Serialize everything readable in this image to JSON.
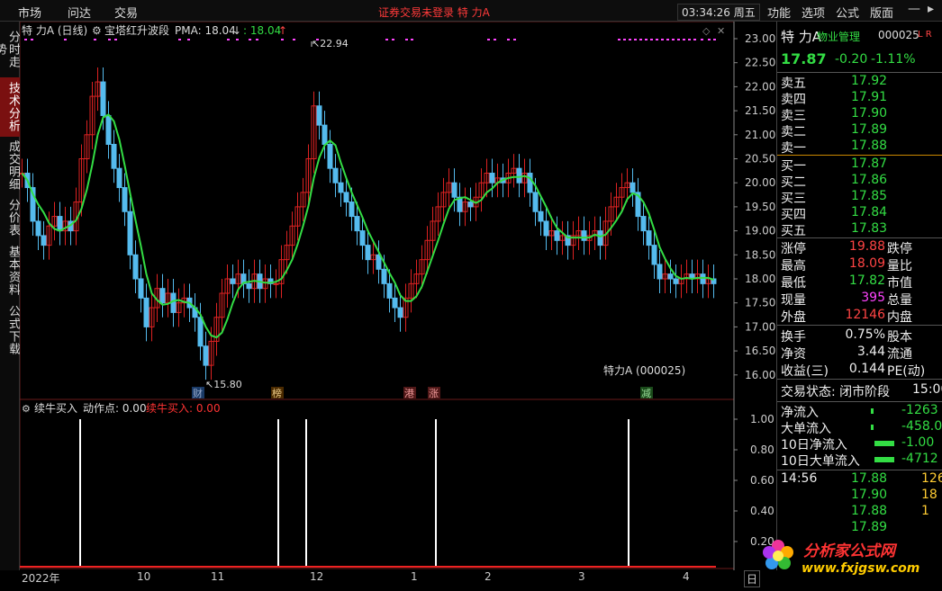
{
  "topbar": {
    "menu_left": [
      "市场",
      "问达",
      "交易"
    ],
    "login_status": "证券交易未登录  特 力A",
    "clock": "03:34:26 周五",
    "menu_right": [
      "功能",
      "选项",
      "公式",
      "版面"
    ]
  },
  "left_tabs": [
    "分时走势",
    "技术分析",
    "成交明细",
    "分价表",
    "基本资料",
    "公式下载"
  ],
  "main_chart": {
    "title": "特 力A (日线)",
    "indicator": "宝塔红升波段",
    "pma_label": "PMA: 18.04",
    "pma2_label": ": 18.04",
    "high_label": "22.94",
    "low_label": "15.80",
    "stock_label": "特力A (000025)",
    "markers": [
      "财",
      "榜",
      "港",
      "涨",
      "减"
    ],
    "y_ticks": [
      "23.00",
      "22.50",
      "22.00",
      "21.50",
      "21.00",
      "20.50",
      "20.00",
      "19.50",
      "19.00",
      "18.50",
      "18.00",
      "17.50",
      "17.00",
      "16.50",
      "16.00"
    ]
  },
  "sub_chart": {
    "title": "续牛买入",
    "action_label": "动作点: 0.00",
    "buy_label": "续牛买入: 0.00",
    "y_ticks": [
      "1.00",
      "0.80",
      "0.60",
      "0.40",
      "0.20"
    ]
  },
  "x_axis": {
    "labels": [
      "2022年",
      "10",
      "11",
      "12",
      "1",
      "2",
      "3",
      "4"
    ],
    "right_label": "日"
  },
  "quote_panel": {
    "name": "特 力A",
    "industry": "物业管理",
    "code": "000025",
    "tag": "L R",
    "price": "17.87",
    "change": "-0.20",
    "change_pct": "-1.11%",
    "asks": [
      {
        "label": "卖五",
        "price": "17.92"
      },
      {
        "label": "卖四",
        "price": "17.91"
      },
      {
        "label": "卖三",
        "price": "17.90"
      },
      {
        "label": "卖二",
        "price": "17.89"
      },
      {
        "label": "卖一",
        "price": "17.88"
      }
    ],
    "bids": [
      {
        "label": "买一",
        "price": "17.87"
      },
      {
        "label": "买二",
        "price": "17.86"
      },
      {
        "label": "买三",
        "price": "17.85"
      },
      {
        "label": "买四",
        "price": "17.84"
      },
      {
        "label": "买五",
        "price": "17.83"
      }
    ],
    "stats": [
      {
        "label": "涨停",
        "value": "19.88",
        "label2": "跌停",
        "color": "red"
      },
      {
        "label": "最高",
        "value": "18.09",
        "label2": "量比",
        "color": "red"
      },
      {
        "label": "最低",
        "value": "17.82",
        "label2": "市值",
        "color": "green"
      },
      {
        "label": "现量",
        "value": "395",
        "label2": "总量",
        "color": "magenta"
      },
      {
        "label": "外盘",
        "value": "12146",
        "label2": "内盘",
        "color": "red"
      }
    ],
    "stats2": [
      {
        "label": "换手",
        "value": "0.75%",
        "label2": "股本"
      },
      {
        "label": "净资",
        "value": "3.44",
        "label2": "流通"
      },
      {
        "label": "收益(三)",
        "value": "0.144",
        "label2": "PE(动)"
      }
    ],
    "trade_status": "交易状态: 闭市阶段",
    "trade_time": "15:00",
    "flows": [
      {
        "label": "净流入",
        "value": "-1263"
      },
      {
        "label": "大单流入",
        "value": "-458.0"
      },
      {
        "label": "10日净流入",
        "value": "-1.00"
      },
      {
        "label": "10日大单流入",
        "value": "-4712"
      }
    ],
    "ticks": [
      {
        "time": "14:56",
        "price": "17.88",
        "vol": "126"
      },
      {
        "time": "",
        "price": "17.90",
        "vol": "18"
      },
      {
        "time": "",
        "price": "17.88",
        "vol": "1"
      },
      {
        "time": "",
        "price": "17.89",
        "vol": ""
      }
    ]
  },
  "logo": {
    "name": "分析家公式网",
    "url": "www.fxjgsw.com"
  }
}
